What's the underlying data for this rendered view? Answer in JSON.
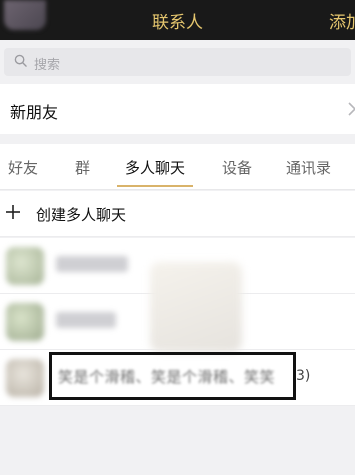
{
  "header": {
    "title": "联系人",
    "add_label": "添加"
  },
  "search": {
    "placeholder": "搜索"
  },
  "new_friends": {
    "label": "新朋友"
  },
  "tabs": [
    {
      "label": "好友",
      "active": false
    },
    {
      "label": "群",
      "active": false
    },
    {
      "label": "多人聊天",
      "active": true
    },
    {
      "label": "设备",
      "active": false
    },
    {
      "label": "通讯录",
      "active": false
    }
  ],
  "create_group": {
    "label": "创建多人聊天"
  },
  "chats": [
    {
      "name": "",
      "count": ""
    },
    {
      "name": "",
      "count": ""
    },
    {
      "name": "笑是个滑稽、笑是个滑稽、笑笑",
      "count": "3)"
    }
  ],
  "colors": {
    "accent": "#d9b36a",
    "header_bg": "#191919",
    "header_text": "#e5c66e"
  }
}
